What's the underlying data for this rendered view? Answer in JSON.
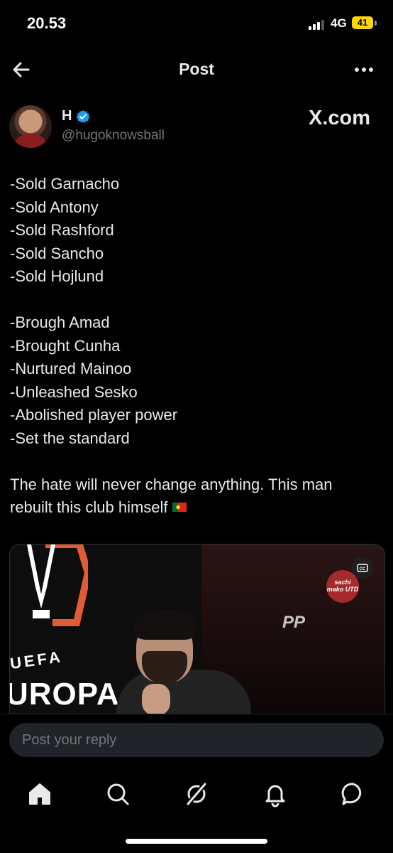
{
  "status_bar": {
    "time": "20.53",
    "network": "4G",
    "battery": "41"
  },
  "header": {
    "title": "Post",
    "back_icon": "arrow-left-icon",
    "more_icon": "more-horizontal-icon"
  },
  "author": {
    "name": "H",
    "handle": "@hugoknowsball",
    "verified": true,
    "verified_color": "#1d9bf0",
    "site_logo": "X.com"
  },
  "post": {
    "lines_group1": [
      "-Sold Garnacho",
      "-Sold Antony",
      "-Sold Rashford",
      "-Sold Sancho",
      "-Sold Hojlund"
    ],
    "lines_group2": [
      "-Brough Amad",
      "-Brought Cunha",
      "-Nurtured Mainoo",
      "-Unleashed Sesko",
      "-Abolished player power",
      "-Set the standard"
    ],
    "closing_line1": "The hate will never change anything. This man",
    "closing_line2": "rebuilt this club himself",
    "flag_icon": "portugal-flag-icon"
  },
  "media": {
    "uefa_text": "UEFA",
    "europa_text": "UROPA",
    "pp_text": "PP",
    "watermark_text": "sachi mako UTD",
    "cc_icon": "closed-captions-icon"
  },
  "reply": {
    "placeholder": "Post your reply"
  },
  "nav": {
    "items": [
      {
        "icon": "home-icon"
      },
      {
        "icon": "search-icon"
      },
      {
        "icon": "grok-icon"
      },
      {
        "icon": "notifications-bell-icon"
      },
      {
        "icon": "messages-icon"
      }
    ]
  },
  "colors": {
    "background": "#000000",
    "text": "#e7e9ea",
    "muted": "#71767b",
    "accent": "#1d9bf0",
    "battery": "#ffd60a"
  }
}
